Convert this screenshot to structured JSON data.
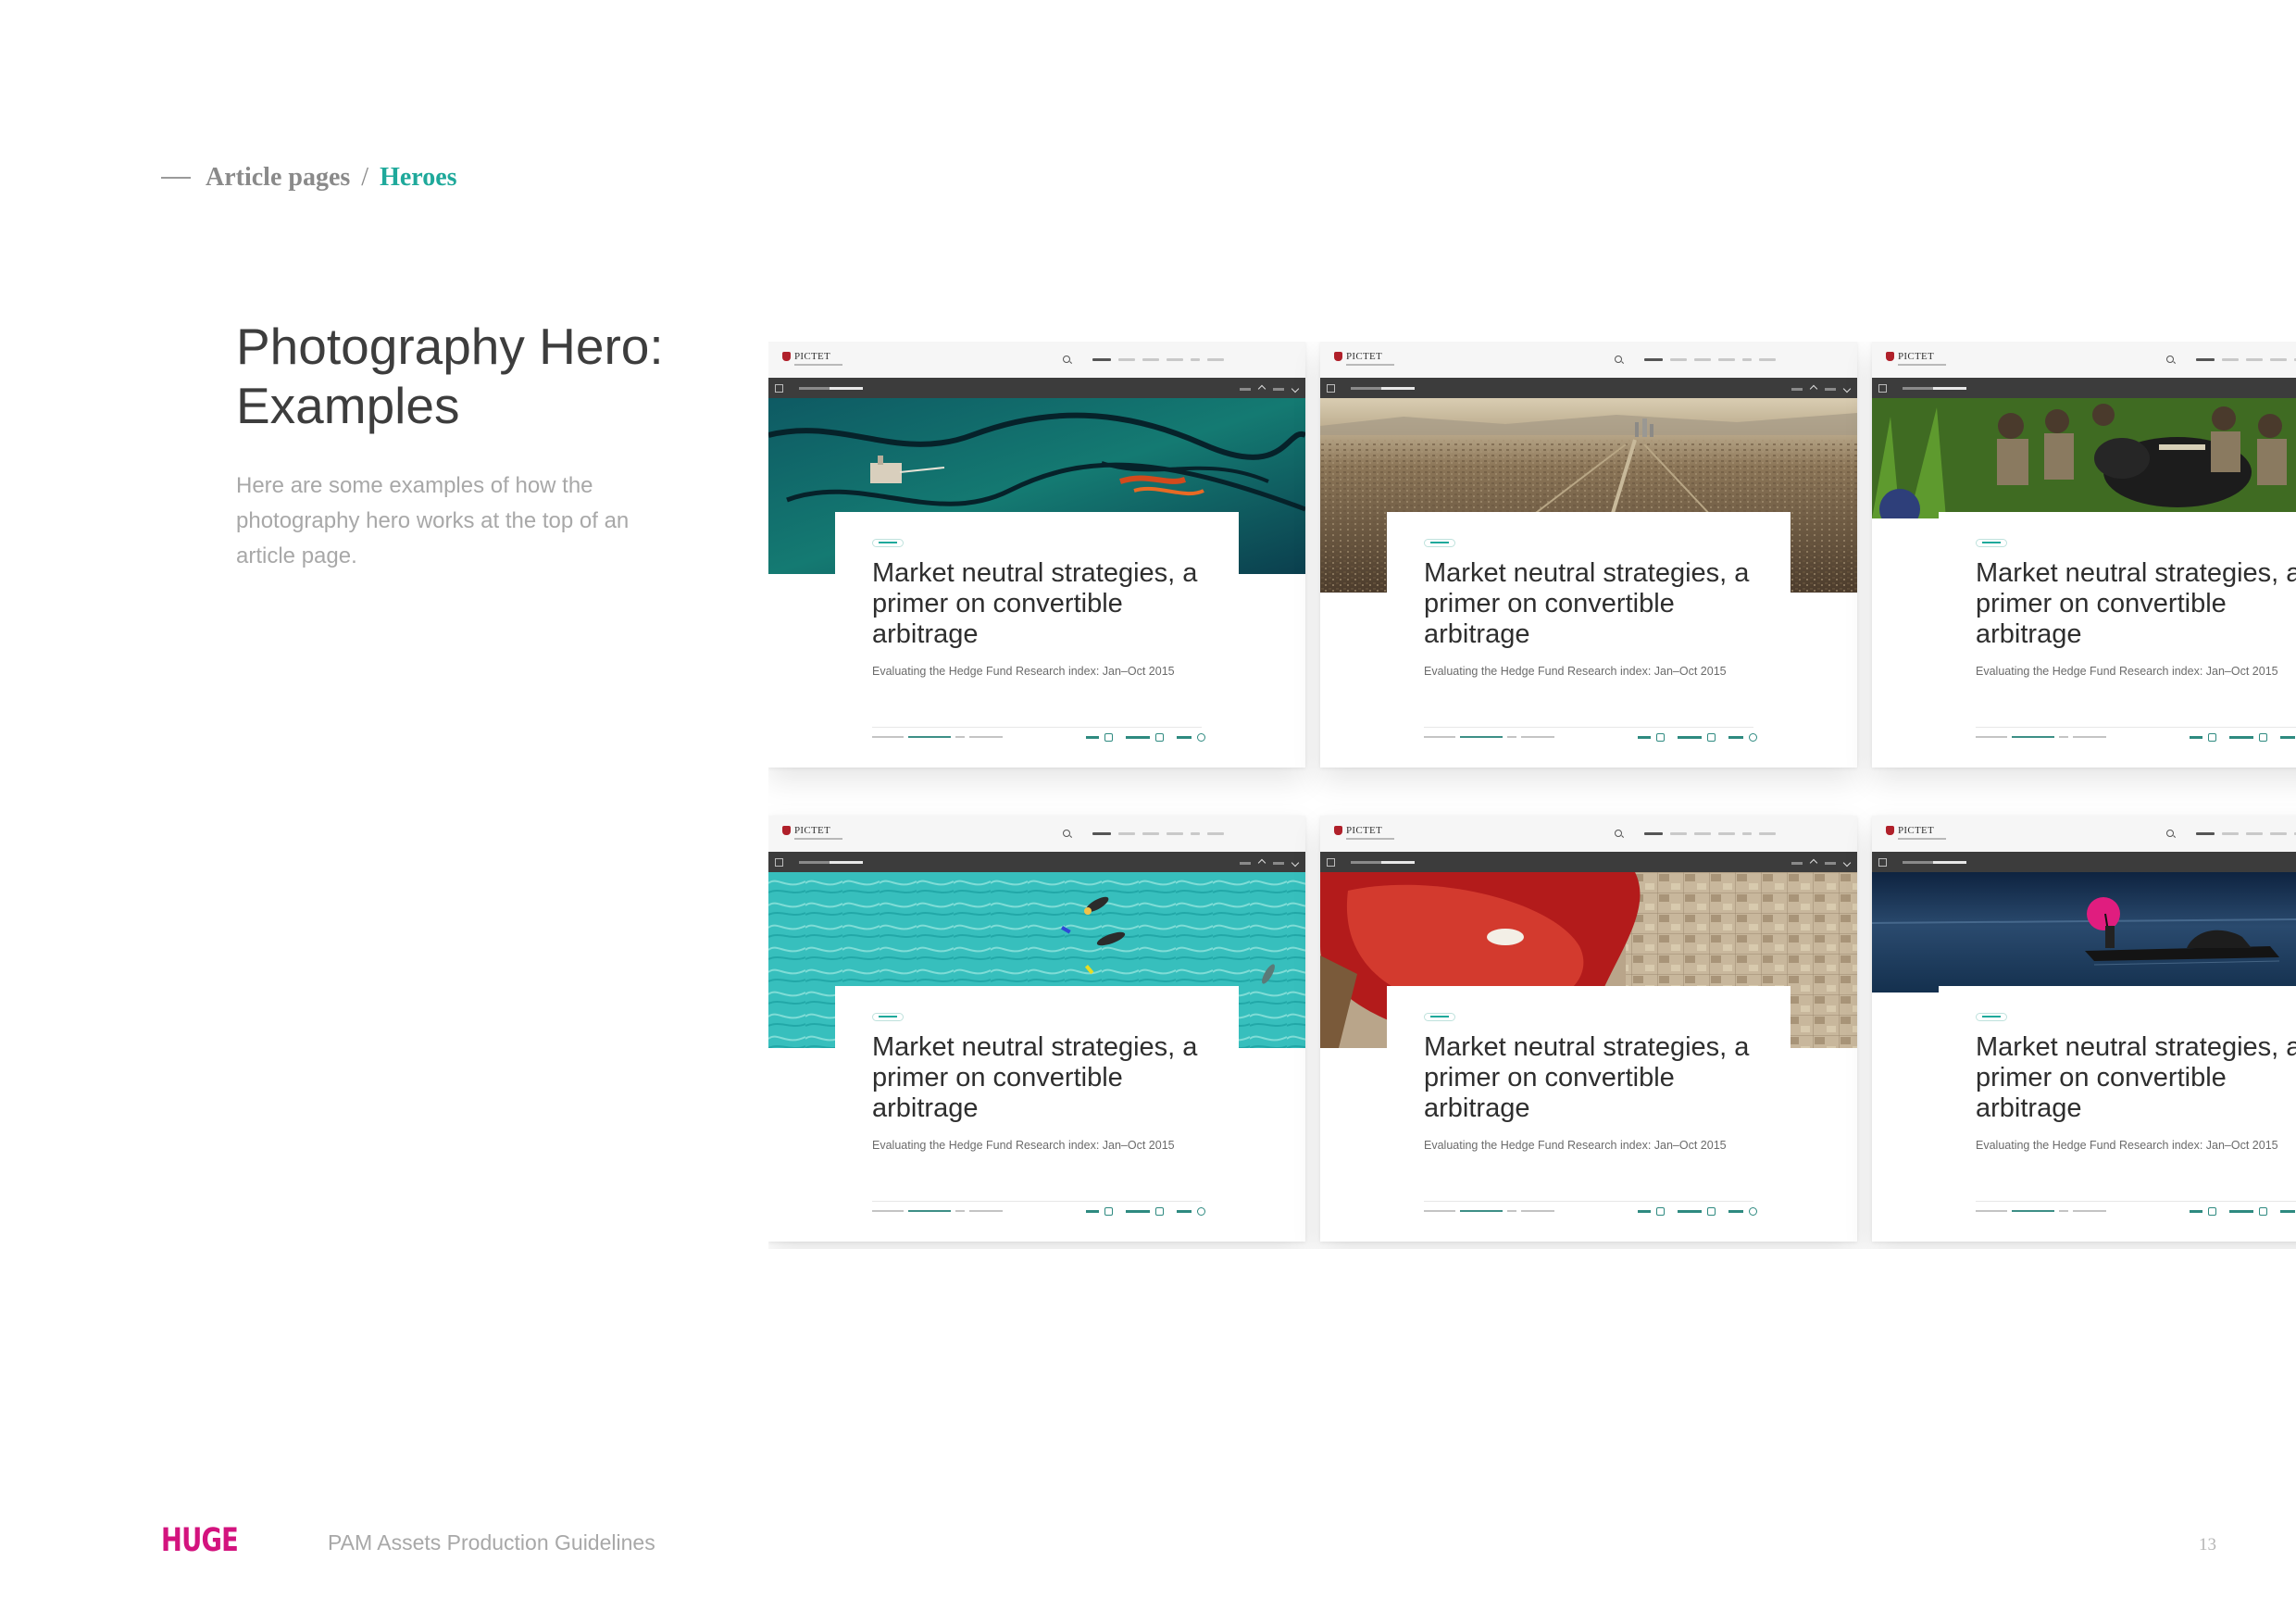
{
  "breadcrumb": {
    "section": "Article pages",
    "separator": "/",
    "current": "Heroes"
  },
  "page": {
    "title": "Photography Hero: Examples",
    "description": "Here are some examples of how the photography hero works at the top of an article page."
  },
  "example_article": {
    "logo_text": "PICTET",
    "headline": "Market neutral strategies, a primer on convertible arbitrage",
    "subheadline": "Evaluating the Hedge Fund Research index: Jan–Oct 2015"
  },
  "examples": [
    {
      "hero_image": "aerial-oil-spill-ocean"
    },
    {
      "hero_image": "aerial-city-sprawl"
    },
    {
      "hero_image": "rescue-team-gorilla-jungle"
    },
    {
      "hero_image": "aerial-swimmers-turquoise-water"
    },
    {
      "hero_image": "aerial-red-mining-pond-grid"
    },
    {
      "hero_image": "boat-pink-umbrella-lake"
    }
  ],
  "footer": {
    "brand": "HUGE",
    "doc_title": "PAM Assets Production Guidelines",
    "page_number": "13"
  },
  "colors": {
    "accent": "#1fa99b",
    "brand": "#d3137e",
    "text_dark": "#3d3d3d",
    "text_muted": "#a8a8a8"
  }
}
